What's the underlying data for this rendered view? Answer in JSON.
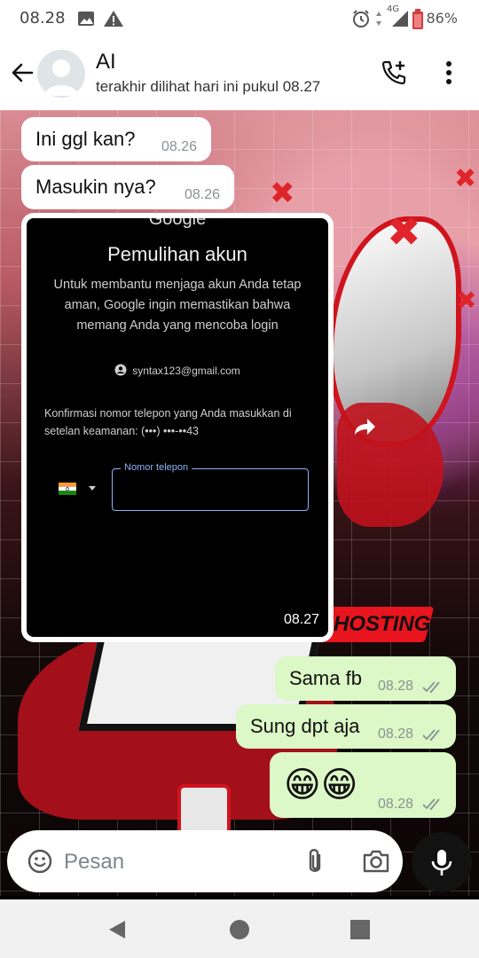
{
  "status_bar": {
    "time": "08.28",
    "battery": "86%",
    "network": "4G"
  },
  "header": {
    "name": "AI",
    "last_seen": "terakhir dilihat hari ini pukul 08.27"
  },
  "messages": [
    {
      "dir": "in",
      "text": "Ini ggl kan?",
      "time": "08.26"
    },
    {
      "dir": "in",
      "text": "Masukin nya?",
      "time": "08.26"
    },
    {
      "dir": "out",
      "text": "Sama fb",
      "time": "08.28"
    },
    {
      "dir": "out",
      "text": "Sung dpt aja",
      "time": "08.28"
    },
    {
      "dir": "out",
      "text": "😁😁",
      "time": "08.28"
    }
  ],
  "image_message": {
    "time": "08.27",
    "logo": "Google",
    "title": "Pemulihan akun",
    "description": "Untuk membantu menjaga akun Anda tetap aman, Google ingin memastikan bahwa memang Anda yang mencoba login",
    "account": "syntax123@gmail.com",
    "confirm_text": "Konfirmasi nomor telepon yang Anda masukkan di setelan keamanan: (•••) •••-••43",
    "phone_label": "Nomor telepon"
  },
  "wallpaper_text": "HOSTING",
  "input": {
    "placeholder": "Pesan"
  },
  "colors": {
    "outgoing_bubble": "#dcf8c6",
    "incoming_bubble": "#ffffff",
    "tick": "#8a9295",
    "accent_blue": "#8ab4f8"
  }
}
